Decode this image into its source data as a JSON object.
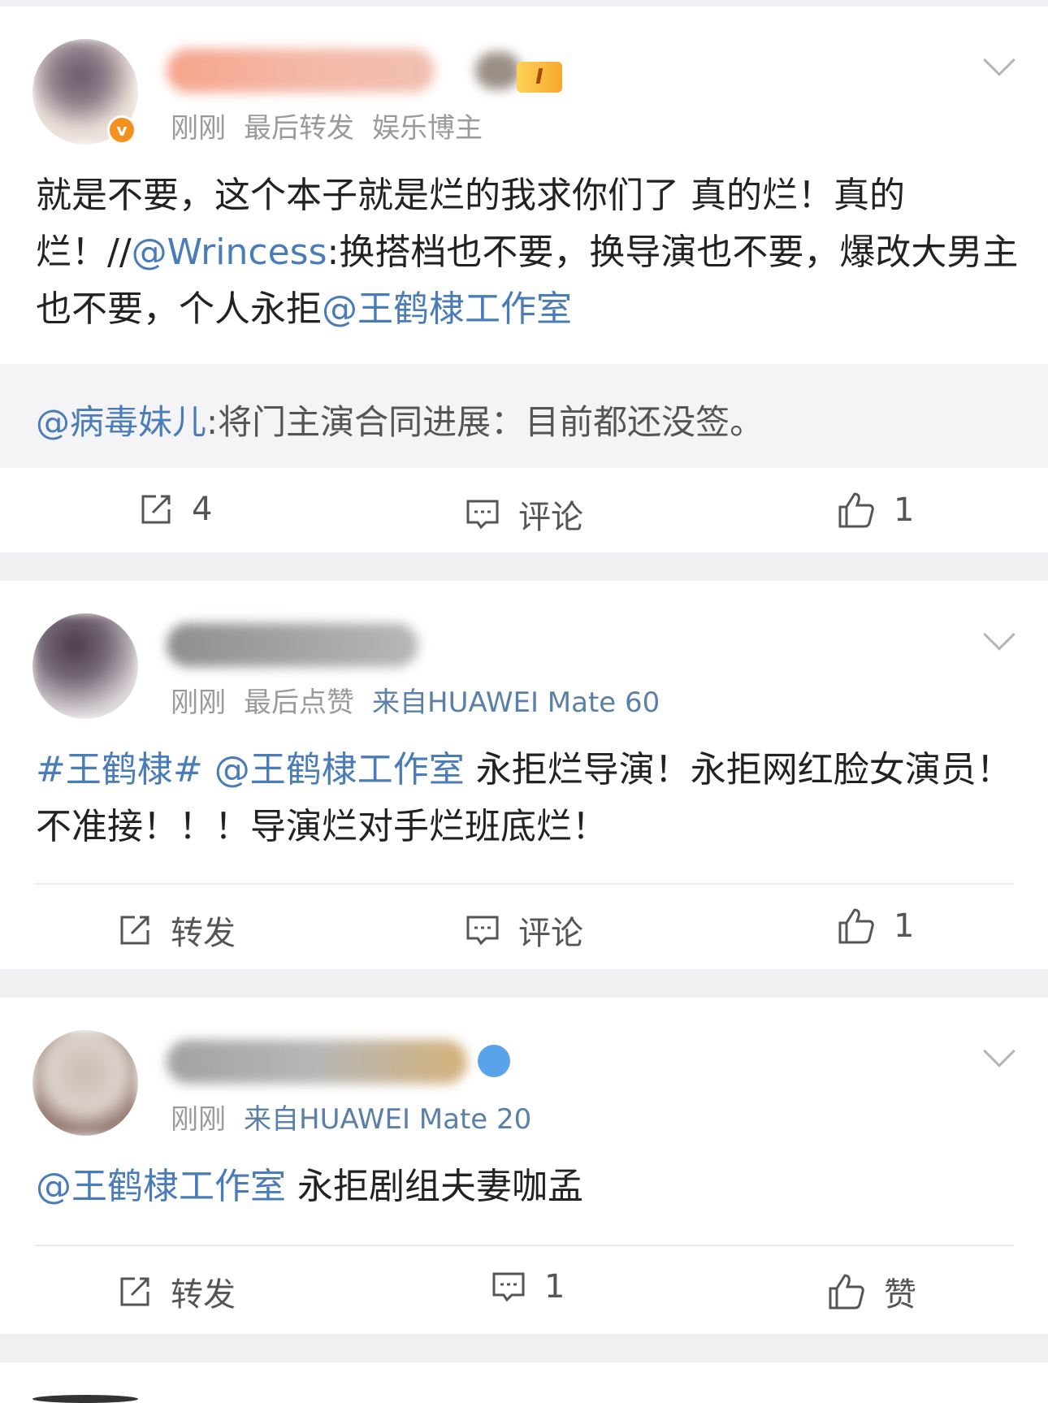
{
  "posts": [
    {
      "meta": [
        "刚刚",
        "最后转发",
        "娱乐博主"
      ],
      "badge_level": "I",
      "text_parts": {
        "a": "就是不要，这个本子就是烂的我求你们了 真的烂！真的烂！//",
        "b": "@Wrincess",
        "c": ":换搭档也不要，换导演也不要，爆改大男主也不要，个人永拒",
        "d": "@王鹤棣工作室"
      },
      "quote": {
        "mention": "@病毒妹儿",
        "text": ":将门主演合同进展：目前都还没签。"
      },
      "actions": {
        "repost": "4",
        "comment": "评论",
        "like": "1"
      }
    },
    {
      "meta": [
        "刚刚",
        "最后点赞"
      ],
      "source": "来自HUAWEI Mate 60",
      "text_parts": {
        "a": "#王鹤棣#",
        "b": " @王鹤棣工作室",
        "c": " 永拒烂导演！永拒网红脸女演员！不准接！！！导演烂对手烂班底烂！"
      },
      "actions": {
        "repost": "转发",
        "comment": "评论",
        "like": "1"
      }
    },
    {
      "meta": [
        "刚刚"
      ],
      "source": "来自HUAWEI Mate 20",
      "text_parts": {
        "a": "@王鹤棣工作室",
        "b": " 永拒剧组夫妻咖孟"
      },
      "actions": {
        "repost": "转发",
        "comment": "1",
        "like": "赞"
      }
    }
  ],
  "icons": [
    "repost-icon",
    "comment-icon",
    "like-icon",
    "chevron-down-icon",
    "vip-badge-icon",
    "level-badge-icon",
    "fish-badge-icon"
  ],
  "colors": {
    "link": "#4a7cb8",
    "meta": "#9a9a9a",
    "badge": "#f5901e",
    "background": "#f0f0f2"
  }
}
